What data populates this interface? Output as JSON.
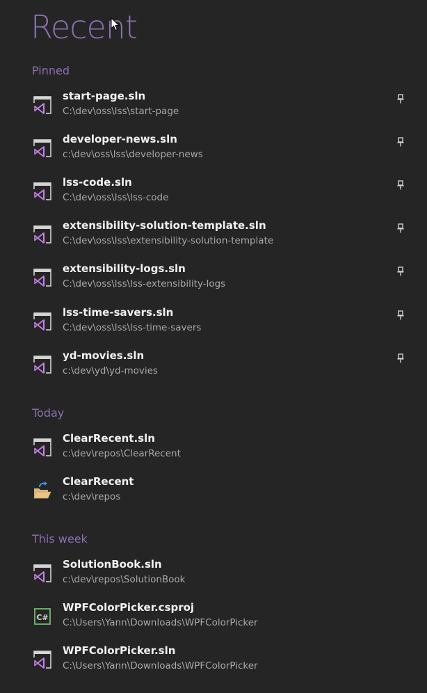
{
  "page": {
    "title": "Recent"
  },
  "sections": [
    {
      "header": "Pinned",
      "items": [
        {
          "name": "start-page.sln",
          "path": "C:\\dev\\oss\\lss\\start-page",
          "icon": "vs-solution-icon",
          "pinned": true
        },
        {
          "name": "developer-news.sln",
          "path": "c:\\dev\\oss\\lss\\developer-news",
          "icon": "vs-solution-icon",
          "pinned": true
        },
        {
          "name": "lss-code.sln",
          "path": "C:\\dev\\oss\\lss\\lss-code",
          "icon": "vs-solution-icon",
          "pinned": true
        },
        {
          "name": "extensibility-solution-template.sln",
          "path": "C:\\dev\\oss\\lss\\extensibility-solution-template",
          "icon": "vs-solution-icon",
          "pinned": true
        },
        {
          "name": "extensibility-logs.sln",
          "path": "C:\\dev\\oss\\lss\\lss-extensibility-logs",
          "icon": "vs-solution-icon",
          "pinned": true
        },
        {
          "name": "lss-time-savers.sln",
          "path": "C:\\dev\\oss\\lss\\lss-time-savers",
          "icon": "vs-solution-icon",
          "pinned": true
        },
        {
          "name": "yd-movies.sln",
          "path": "c:\\dev\\yd\\yd-movies",
          "icon": "vs-solution-icon",
          "pinned": true
        }
      ]
    },
    {
      "header": "Today",
      "items": [
        {
          "name": "ClearRecent.sln",
          "path": "c:\\dev\\repos\\ClearRecent",
          "icon": "vs-solution-icon",
          "pinned": false
        },
        {
          "name": "ClearRecent",
          "path": "c:\\dev\\repos",
          "icon": "open-folder-icon",
          "pinned": false
        }
      ]
    },
    {
      "header": "This week",
      "items": [
        {
          "name": "SolutionBook.sln",
          "path": "c:\\dev\\repos\\SolutionBook",
          "icon": "vs-solution-icon",
          "pinned": false
        },
        {
          "name": "WPFColorPicker.csproj",
          "path": "C:\\Users\\Yann\\Downloads\\WPFColorPicker",
          "icon": "csharp-project-icon",
          "pinned": false
        },
        {
          "name": "WPFColorPicker.sln",
          "path": "C:\\Users\\Yann\\Downloads\\WPFColorPicker",
          "icon": "vs-solution-icon",
          "pinned": false
        }
      ]
    }
  ],
  "colors": {
    "background": "#252526",
    "accent": "#8b6fae",
    "text": "#f1f1f1",
    "subtext": "#a9a9a9",
    "vs_purple": "#c57fe0",
    "csharp_green": "#6bbf6b",
    "folder_yellow": "#dcb67a",
    "refresh_blue": "#3aa0e0"
  }
}
